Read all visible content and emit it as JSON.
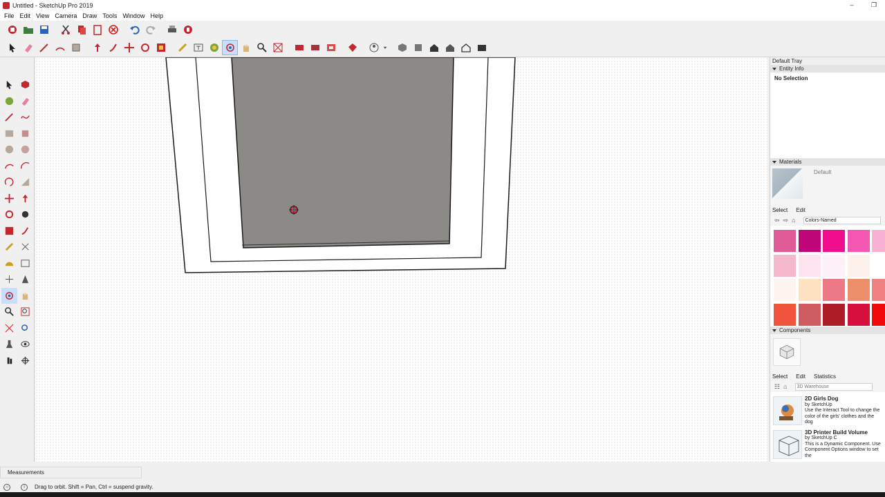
{
  "window": {
    "title": "Untitled - SketchUp Pro 2019",
    "minimize": "–",
    "restore": "❐"
  },
  "menu": [
    "File",
    "Edit",
    "View",
    "Camera",
    "Draw",
    "Tools",
    "Window",
    "Help"
  ],
  "tray": {
    "title": "Default Tray",
    "entity_info": {
      "header": "Entity Info",
      "selection": "No Selection"
    },
    "materials": {
      "header": "Materials",
      "current": "Default",
      "tabs": [
        "Select",
        "Edit"
      ],
      "library": "Colors-Named",
      "swatches": [
        "#e05a95",
        "#c0077a",
        "#f00e8f",
        "#f457b2",
        "#f8b1d3",
        "#f6b8cc",
        "#fde4ee",
        "#fef0f7",
        "#fdf1ec",
        "#ffffff",
        "#fef5f1",
        "#fde2c2",
        "#ec7985",
        "#ee8f6c",
        "#ef8182",
        "#f2533c",
        "#cd5b5f",
        "#ac1d28",
        "#d60f3c",
        "#f20a0a"
      ]
    },
    "components": {
      "header": "Components",
      "tabs": [
        "Select",
        "Edit",
        "Statistics"
      ],
      "search_placeholder": "3D Warehouse",
      "items": [
        {
          "title": "2D Girls Dog",
          "author": "by SketchUp",
          "description": "Use the Interact Tool to change the color of the girls' clothes and the dog"
        },
        {
          "title": "3D Printer Build Volume",
          "author": "by SketchUp C",
          "description": "This is a Dynamic Component. Use Component Options window to set the"
        }
      ]
    }
  },
  "measurements": {
    "label": "Measurements"
  },
  "status": {
    "hint": "Drag to orbit. Shift = Pan, Ctrl = suspend gravity."
  },
  "colors": {
    "accent_active": "#c9defa",
    "model_fill": "#8b8a86",
    "model_edge": "#1a1a1a"
  }
}
